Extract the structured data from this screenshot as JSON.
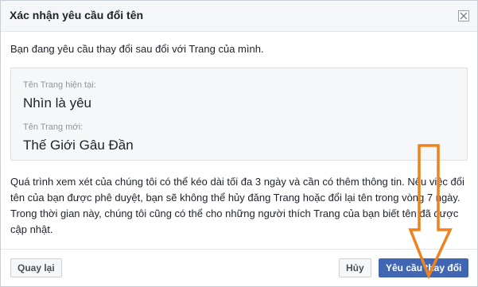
{
  "dialog": {
    "title": "Xác nhận yêu cầu đổi tên",
    "close_icon": "close-icon"
  },
  "body": {
    "intro": "Bạn đang yêu cầu thay đổi sau đổi với Trang của mình.",
    "current_label": "Tên Trang hiện tại:",
    "current_value": "Nhìn là yêu",
    "new_label": "Tên Trang mới:",
    "new_value": "Thế Giới Gâu Đần",
    "paragraph": "Quá trình xem xét của chúng tôi có thể kéo dài tối đa 3 ngày và cần có thêm thông tin. Nếu việc đổi tên của bạn được phê duyệt, bạn sẽ không thể hủy đăng Trang hoặc đổi lại tên trong vòng 7 ngày. Trong thời gian này, chúng tôi cũng có thể cho những người thích Trang của bạn biết tên đã được cập nhật."
  },
  "footer": {
    "back_label": "Quay lại",
    "cancel_label": "Hủy",
    "confirm_label": "Yêu cầu thay đổi"
  },
  "colors": {
    "primary": "#4267b2",
    "annotation_arrow": "#f0821e"
  },
  "annotation": {
    "icon": "orange-down-arrow-icon"
  }
}
